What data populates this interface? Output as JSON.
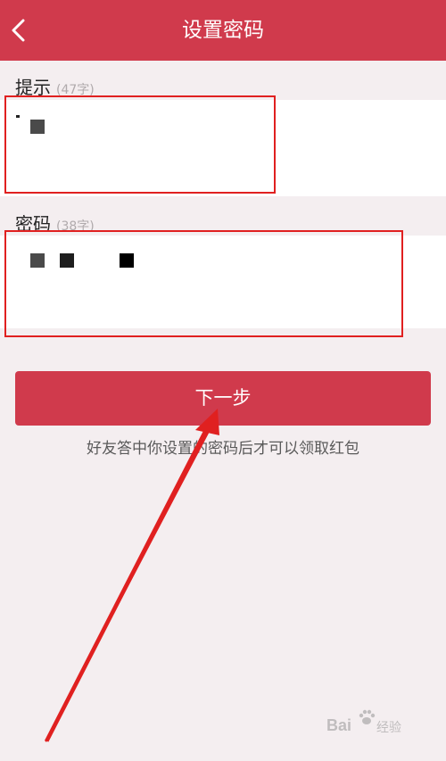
{
  "header": {
    "title": "设置密码",
    "back_icon": "chevron-left-icon",
    "background_color": "#d03a4c"
  },
  "hint_section": {
    "label": "提示",
    "count": "(47字)"
  },
  "password_section": {
    "label": "密码",
    "count": "(38字)"
  },
  "next_button": {
    "label": "下一步"
  },
  "footer_hint": "好友答中你设置的密码后才可以领取红包",
  "annotation_color": "#e02020",
  "watermark": {
    "brand": "Bai",
    "suffix": "经验",
    "icon": "baidu-paw-icon"
  }
}
